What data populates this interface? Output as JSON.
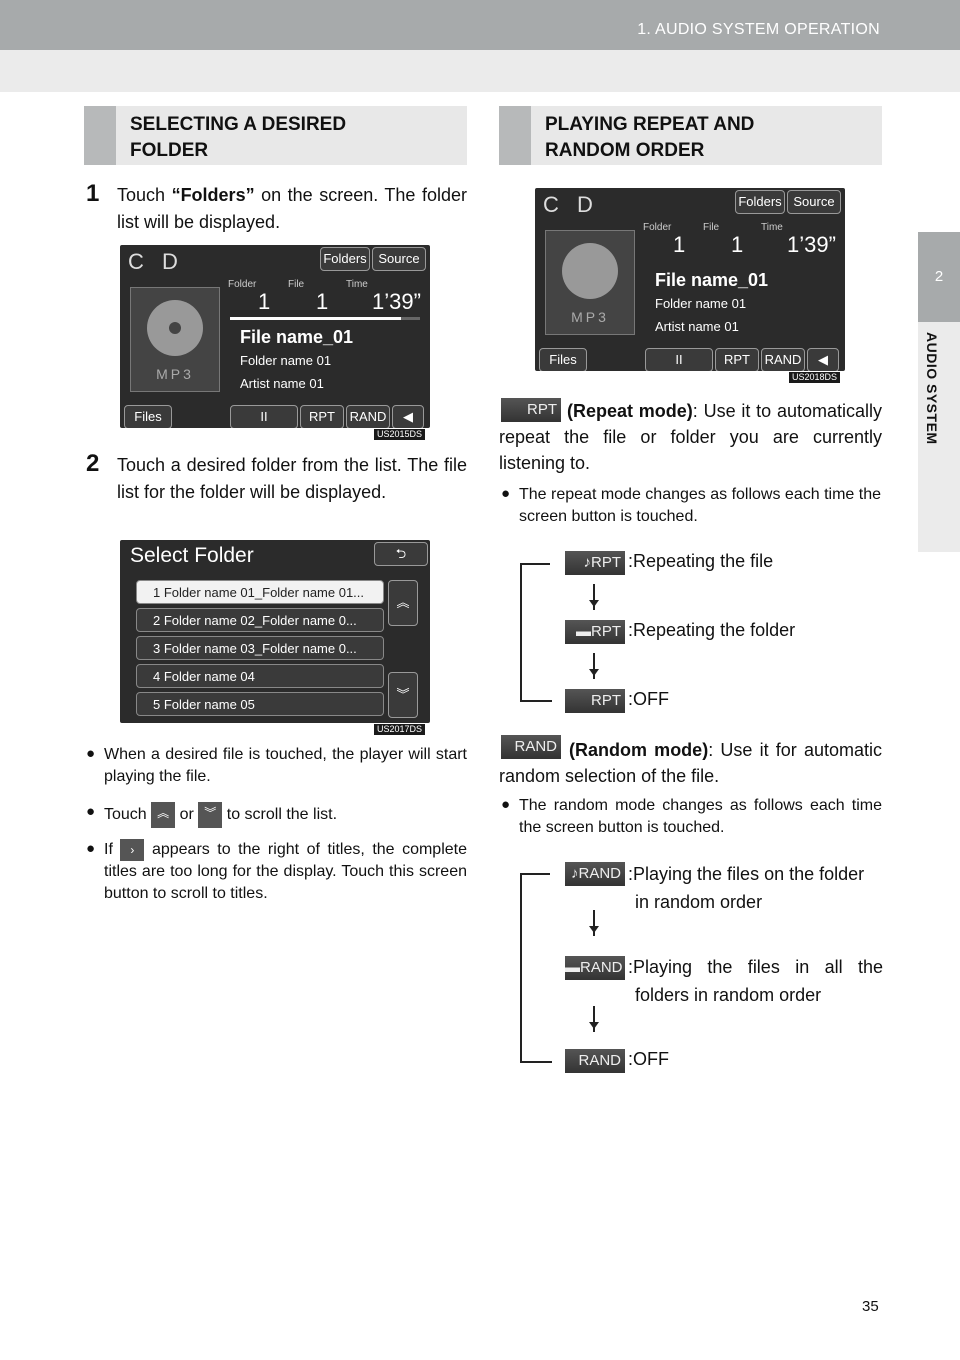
{
  "header": {
    "title": "1. AUDIO SYSTEM OPERATION"
  },
  "side_tab": {
    "number": "2",
    "label": "AUDIO SYSTEM"
  },
  "page_number": "35",
  "left": {
    "section_title": "SELECTING A DESIRED\nFOLDER",
    "step1": {
      "num": "1",
      "pre": "Touch ",
      "bold": "“Folders”",
      "post": " on the screen. The folder list will be displayed."
    },
    "screen1": {
      "source": "C D",
      "folders_btn": "Folders",
      "source_btn": "Source",
      "folder_lbl": "Folder",
      "file_lbl": "File",
      "time_lbl": "Time",
      "folder_val": "1",
      "file_val": "1",
      "time_val": "1’39”",
      "file_name": "File name_01",
      "folder_name": "Folder name 01",
      "artist_name": "Artist name 01",
      "disc_label": "MP3",
      "files_btn": "Files",
      "pause_btn": "II",
      "rpt_btn": "RPT",
      "rand_btn": "RAND",
      "code": "US2015DS",
      "progress": 0.9
    },
    "step2": {
      "num": "2",
      "text": "Touch a desired folder from the list. The file list for the folder will be displayed."
    },
    "screen2": {
      "title": "Select Folder",
      "back": "⮌",
      "rows": [
        "1  Folder name 01_Folder name 01...",
        "2  Folder name 02_Folder name 0...",
        "3  Folder name 03_Folder name 0...",
        "4  Folder name 04",
        "5  Folder name 05"
      ],
      "code": "US2017DS"
    },
    "bullets": {
      "b1": "When a desired file is touched, the player will start playing the file.",
      "b2_pre": "Touch",
      "b2_mid": "or",
      "b2_post": "to scroll the list.",
      "b3_pre": "If",
      "b3_post": "appears to the right of titles, the complete titles are too long for the display. Touch this screen button to scroll to titles."
    }
  },
  "right": {
    "section_title": "PLAYING REPEAT AND\nRANDOM ORDER",
    "screen": {
      "code": "US2018DS"
    },
    "repeat": {
      "chip": "RPT",
      "bold": "(Repeat mode)",
      "text": ": Use it to automatically repeat the file or folder you are currently listening to.",
      "bullet": "The repeat mode changes as follows each time the screen button is touched.",
      "states": [
        ":Repeating the file",
        ":Repeating the folder",
        ":OFF"
      ]
    },
    "random": {
      "chip": "RAND",
      "bold": "(Random mode)",
      "text": ": Use it for automatic random selection of the file.",
      "bullet": "The random mode changes as follows each time the screen button is touched.",
      "states": [
        ":Playing the files on the folder in random order",
        ":Playing the files in all the folders in random order",
        ":OFF"
      ]
    }
  }
}
